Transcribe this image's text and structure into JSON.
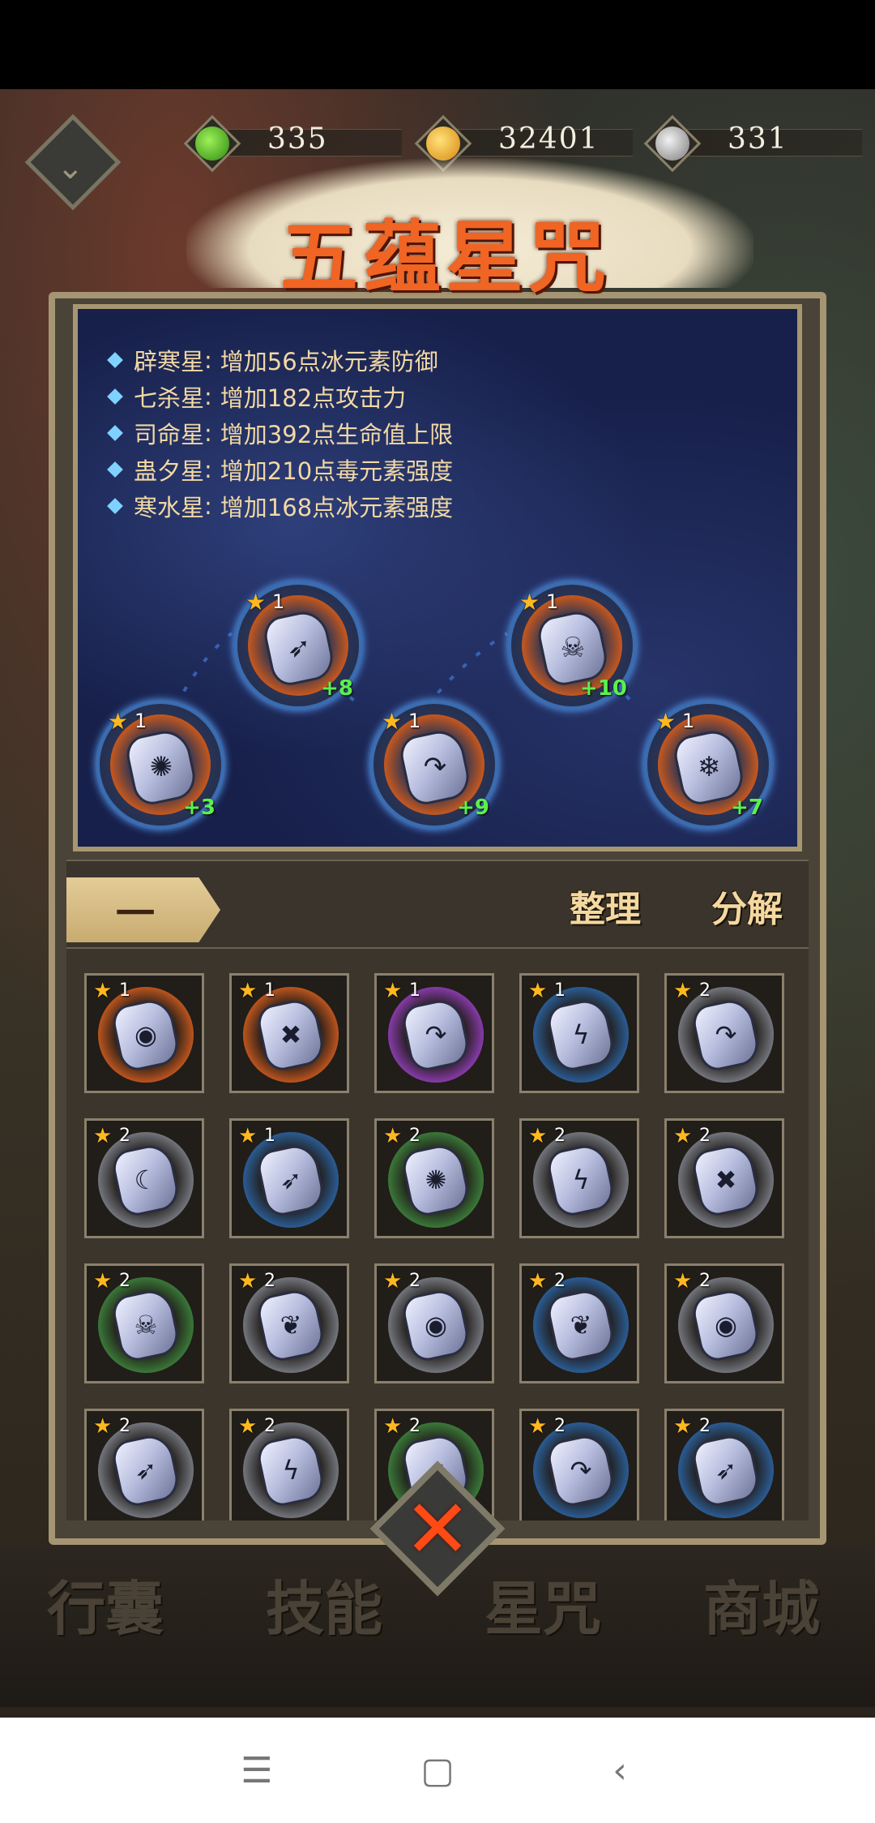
{
  "currencies": [
    {
      "name": "jade",
      "icon": "green-swirl-icon",
      "value": "335",
      "color": "#5bd12a"
    },
    {
      "name": "gold",
      "icon": "gold-coin-icon",
      "value": "32401",
      "color": "#f2a91e"
    },
    {
      "name": "silver",
      "icon": "silver-swirl-icon",
      "value": "331",
      "color": "#bfbfbf"
    }
  ],
  "title": "五蕴星咒",
  "bonuses": [
    {
      "name": "辟寒星",
      "sep": ":",
      "effect": "增加56点冰元素防御"
    },
    {
      "name": "七杀星",
      "sep": ":",
      "effect": "增加182点攻击力"
    },
    {
      "name": "司命星",
      "sep": ":",
      "effect": "增加392点生命值上限"
    },
    {
      "name": "蛊夕星",
      "sep": ":",
      "effect": "增加210点毒元素强度"
    },
    {
      "name": "寒水星",
      "sep": ":",
      "effect": "增加168点冰元素强度"
    }
  ],
  "slots": [
    {
      "level": "1",
      "plus": "+8",
      "symbol": "➶",
      "aura": "orange"
    },
    {
      "level": "1",
      "plus": "+10",
      "symbol": "☠",
      "aura": "orange"
    },
    {
      "level": "1",
      "plus": "+3",
      "symbol": "✺",
      "aura": "orange"
    },
    {
      "level": "1",
      "plus": "+9",
      "symbol": "↷",
      "aura": "orange"
    },
    {
      "level": "1",
      "plus": "+7",
      "symbol": "❄",
      "aura": "orange"
    }
  ],
  "tab": {
    "label": "一"
  },
  "actions": {
    "sort": "整理",
    "decompose": "分解"
  },
  "inventory": [
    {
      "level": "1",
      "symbol": "◉",
      "aura": "#c4571e"
    },
    {
      "level": "1",
      "symbol": "✖",
      "aura": "#c4571e"
    },
    {
      "level": "1",
      "symbol": "↷",
      "aura": "#8c3cb0"
    },
    {
      "level": "1",
      "symbol": "ϟ",
      "aura": "#2b5f9a"
    },
    {
      "level": "2",
      "symbol": "↷",
      "aura": "#777a82"
    },
    {
      "level": "2",
      "symbol": "☾",
      "aura": "#777a82"
    },
    {
      "level": "1",
      "symbol": "➶",
      "aura": "#2b5f9a"
    },
    {
      "level": "2",
      "symbol": "✺",
      "aura": "#3b7d3a"
    },
    {
      "level": "2",
      "symbol": "ϟ",
      "aura": "#777a82"
    },
    {
      "level": "2",
      "symbol": "✖",
      "aura": "#777a82"
    },
    {
      "level": "2",
      "symbol": "☠",
      "aura": "#3b7d3a"
    },
    {
      "level": "2",
      "symbol": "❦",
      "aura": "#777a82"
    },
    {
      "level": "2",
      "symbol": "◉",
      "aura": "#777a82"
    },
    {
      "level": "2",
      "symbol": "❦",
      "aura": "#2b5f9a"
    },
    {
      "level": "2",
      "symbol": "◉",
      "aura": "#777a82"
    },
    {
      "level": "2",
      "symbol": "➶",
      "aura": "#777a82"
    },
    {
      "level": "2",
      "symbol": "ϟ",
      "aura": "#777a82"
    },
    {
      "level": "2",
      "symbol": "➶",
      "aura": "#3b7d3a"
    },
    {
      "level": "2",
      "symbol": "↷",
      "aura": "#2b5f9a"
    },
    {
      "level": "2",
      "symbol": "➶",
      "aura": "#2b5f9a"
    }
  ],
  "bottom_nav": [
    "行囊",
    "技能",
    "星咒",
    "商城"
  ],
  "close_label": "✕"
}
